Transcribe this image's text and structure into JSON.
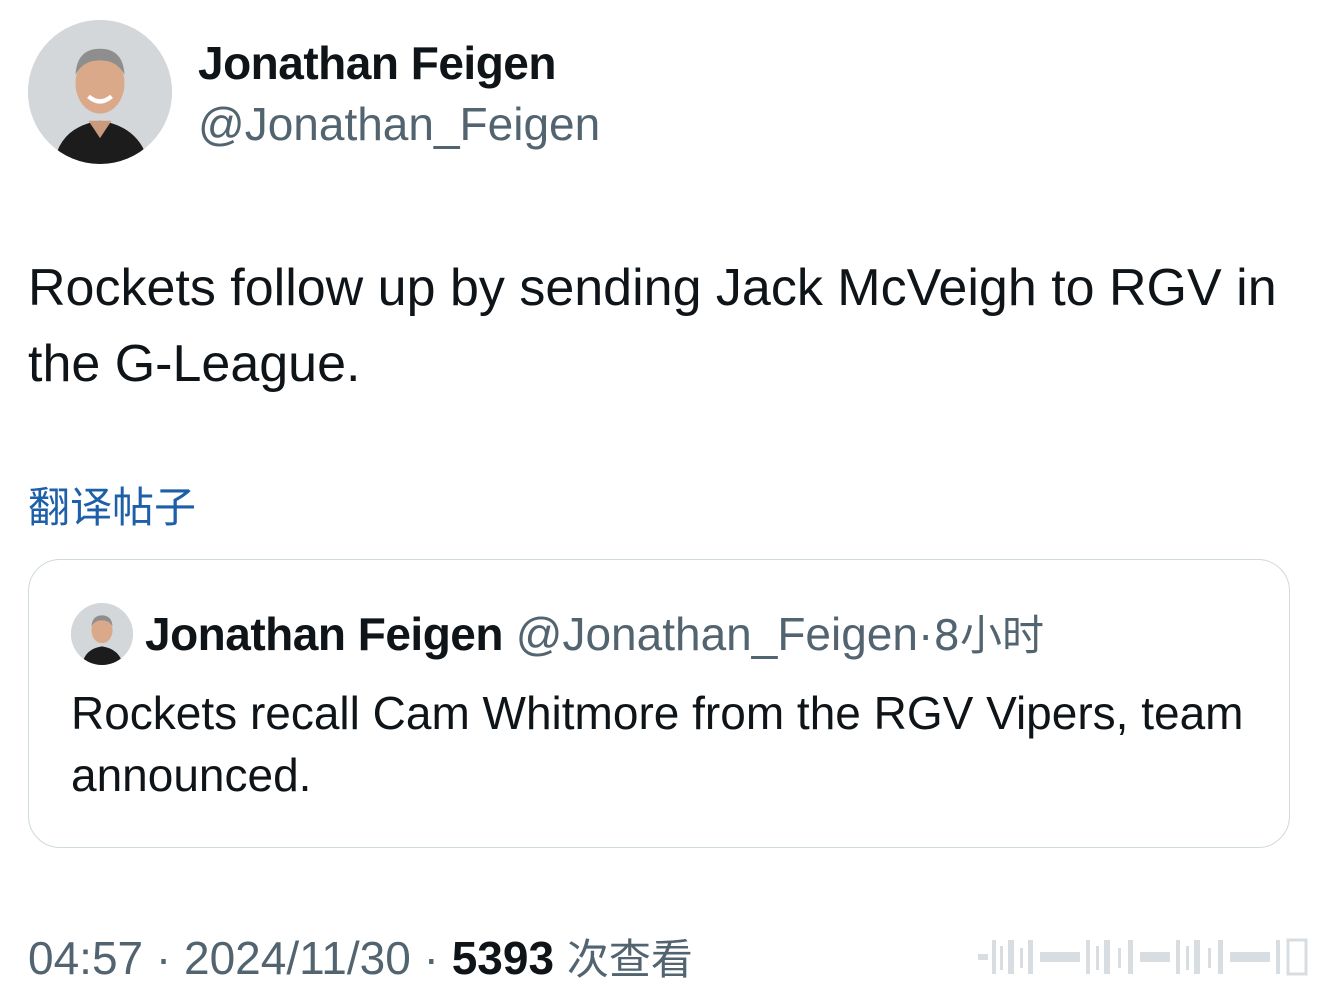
{
  "author": {
    "name": "Jonathan Feigen",
    "handle": "@Jonathan_Feigen"
  },
  "tweet": {
    "text": "Rockets follow up by sending Jack McVeigh to RGV in the G-League.",
    "translate_label": "翻译帖子"
  },
  "quoted_tweet": {
    "name": "Jonathan Feigen",
    "handle": "@Jonathan_Feigen",
    "separator": "·",
    "time": "8小时",
    "text": "Rockets recall Cam Whitmore from the RGV Vipers, team announced."
  },
  "footer": {
    "time": "04:57",
    "separator": "·",
    "date": "2024/11/30",
    "views_count": "5393",
    "views_label": "次查看"
  },
  "icons": {
    "avatar": "avatar-photo",
    "watermark": "barcode-watermark"
  }
}
